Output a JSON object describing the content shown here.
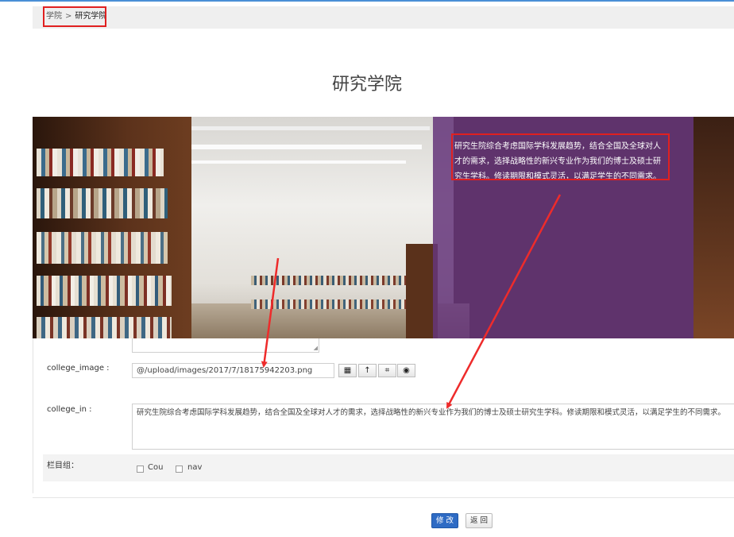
{
  "breadcrumb": {
    "parent": "学院",
    "separator": ">",
    "current": "研究学院"
  },
  "page": {
    "title": "研究学院"
  },
  "hero": {
    "text": "研究生院综合考虑国际学科发展趋势，结合全国及全球对人才的需求，选择战略性的新兴专业作为我们的博士及硕士研究生学科。修读期限和模式灵活，以满足学生的不同需求。"
  },
  "form": {
    "college_image": {
      "label": "college_image :",
      "value": "@/upload/images/2017/7/18175942203.png",
      "buttons": [
        {
          "icon": "grid-icon",
          "glyph": "▦"
        },
        {
          "icon": "upload-arrow-icon",
          "glyph": "↑"
        },
        {
          "icon": "crop-icon",
          "glyph": "⌗"
        },
        {
          "icon": "eye-icon",
          "glyph": "◉"
        }
      ]
    },
    "college_in": {
      "label": "college_in :",
      "value": "研究生院综合考虑国际学科发展趋势，结合全国及全球对人才的需求，选择战略性的新兴专业作为我们的博士及硕士研究生学科。修读期限和模式灵活，以满足学生的不同需求。"
    },
    "column_group": {
      "label": "栏目组：",
      "options": [
        {
          "label": "Cou",
          "checked": false
        },
        {
          "label": "nav",
          "checked": false
        }
      ]
    }
  },
  "actions": {
    "save": "修 改",
    "back": "返 回"
  },
  "colors": {
    "primary": "#2e6bc4",
    "overlay": "#65357a",
    "highlight": "#e02020"
  }
}
